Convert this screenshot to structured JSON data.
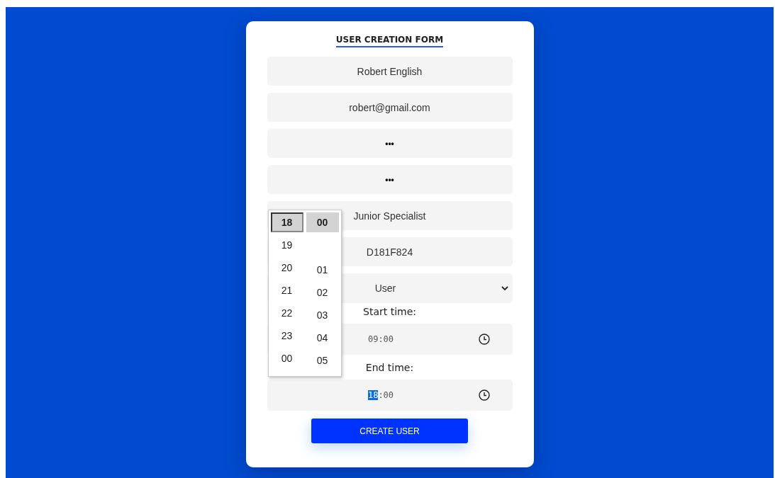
{
  "form": {
    "title": "USER CREATION FORM",
    "fields": [
      {
        "kind": "text",
        "value": "Robert English"
      },
      {
        "kind": "text",
        "value": "robert@gmail.com"
      },
      {
        "kind": "password",
        "value": "•••"
      },
      {
        "kind": "password",
        "value": "•••"
      },
      {
        "kind": "text",
        "value": "Junior Specialist"
      },
      {
        "kind": "text",
        "value": "D181F824"
      },
      {
        "kind": "select",
        "value": "User"
      }
    ],
    "times": [
      {
        "label": "Start time:",
        "hour": "09",
        "separator": ":",
        "minute": "00",
        "hour_selected": false
      },
      {
        "label": "End time:",
        "hour": "18",
        "separator": ":",
        "minute": "00",
        "hour_selected": true
      }
    ],
    "submit": "CREATE USER"
  },
  "time_picker": {
    "hours": [
      {
        "label": "18",
        "selected": true
      },
      {
        "label": "19",
        "selected": false
      },
      {
        "label": "20",
        "selected": false
      },
      {
        "label": "21",
        "selected": false
      },
      {
        "label": "22",
        "selected": false
      },
      {
        "label": "23",
        "selected": false
      },
      {
        "label": "00",
        "selected": false
      }
    ],
    "minutes": [
      {
        "label": "00",
        "selected": true
      },
      {
        "label": "01",
        "selected": false
      },
      {
        "label": "02",
        "selected": false
      },
      {
        "label": "03",
        "selected": false
      },
      {
        "label": "04",
        "selected": false
      },
      {
        "label": "05",
        "selected": false
      }
    ]
  }
}
